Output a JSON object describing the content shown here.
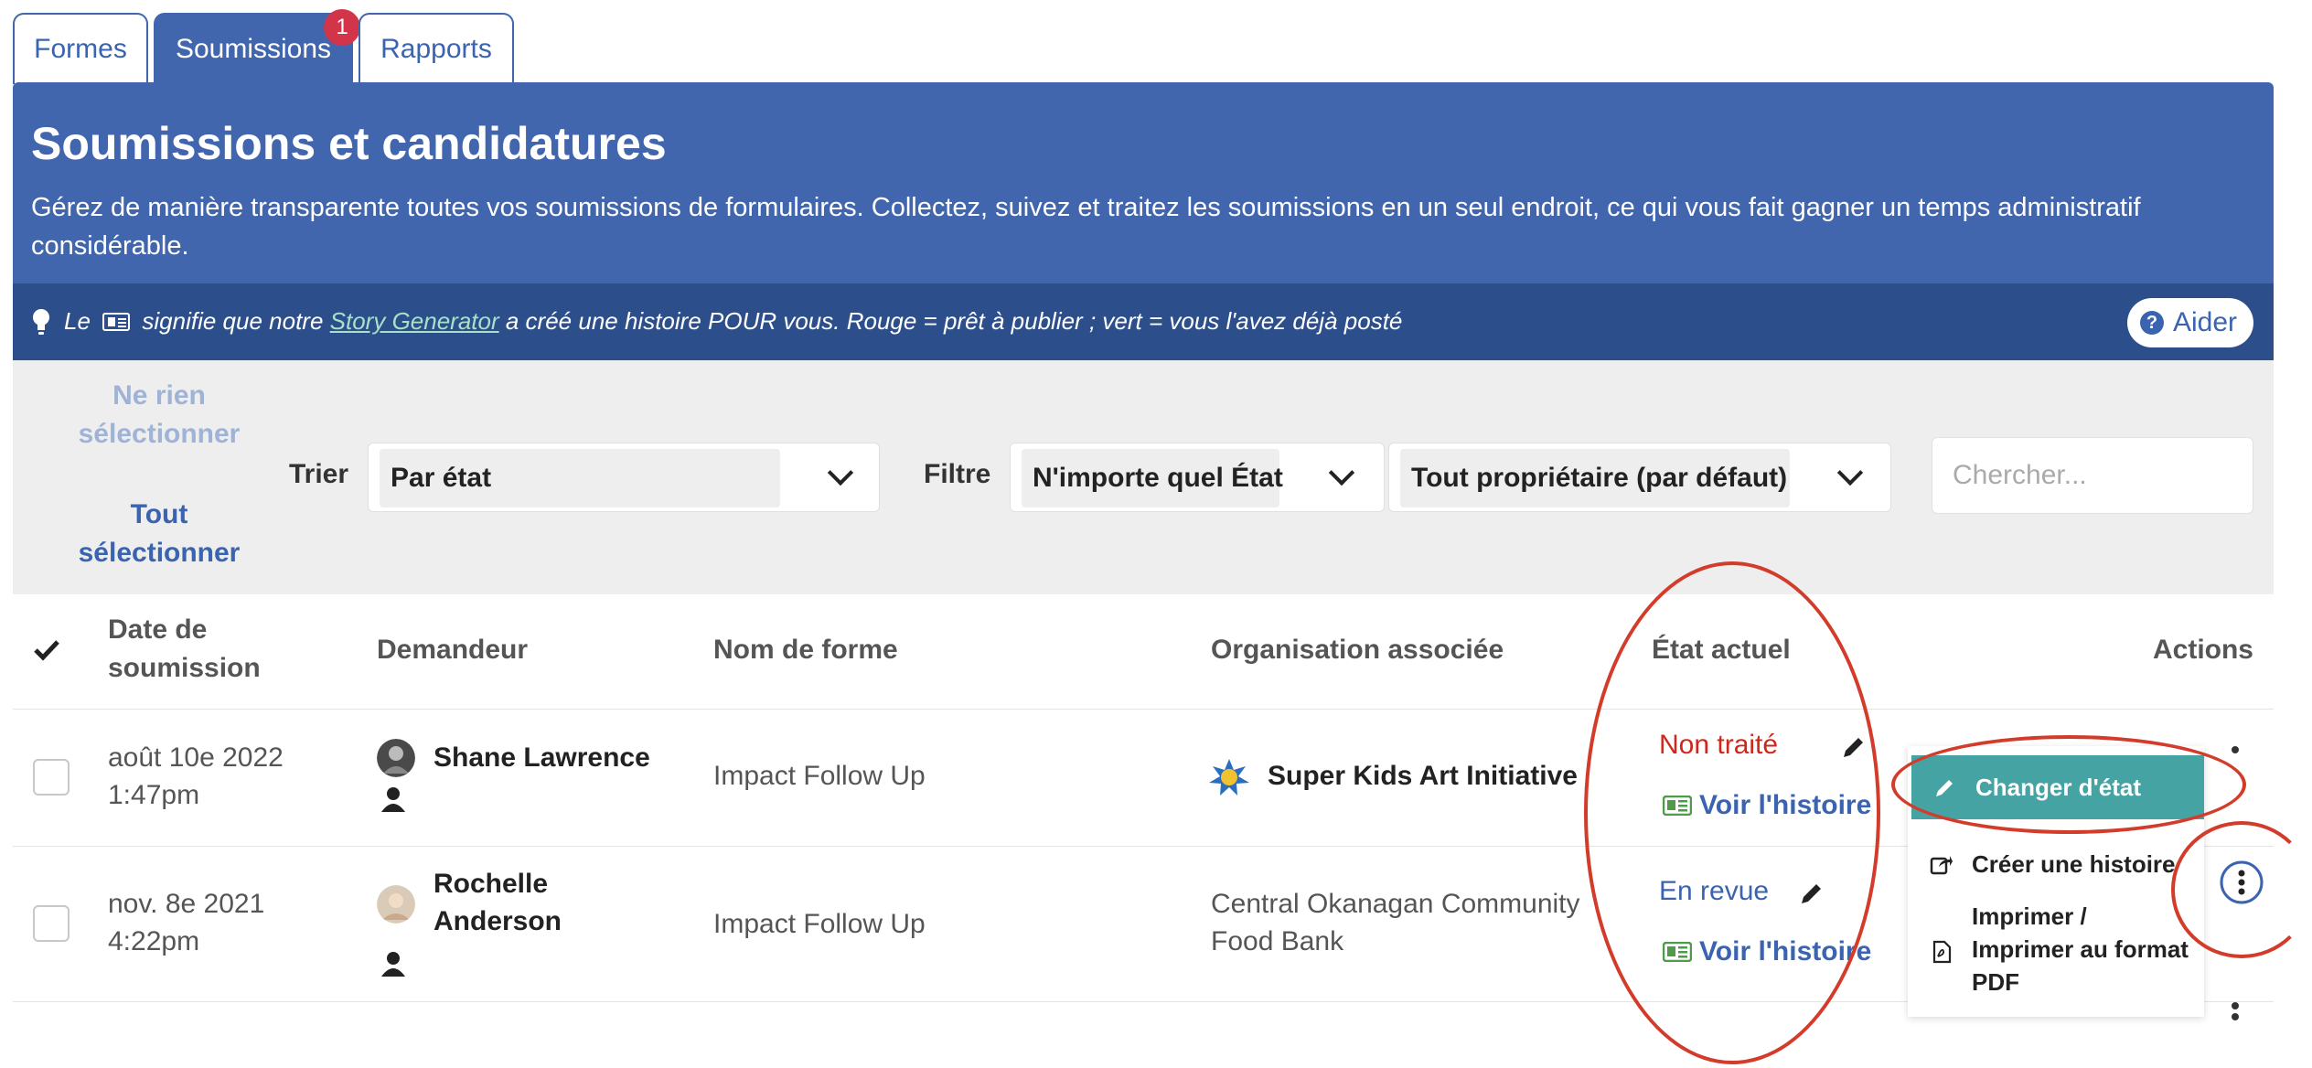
{
  "tabs": [
    {
      "label": "Formes"
    },
    {
      "label": "Soumissions",
      "badge": "1"
    },
    {
      "label": "Rapports"
    }
  ],
  "header": {
    "title": "Soumissions et candidatures",
    "description": "Gérez de manière transparente toutes vos soumissions de formulaires. Collectez, suivez et traitez les soumissions en un seul endroit, ce qui vous fait gagner un temps administratif considérable."
  },
  "infobar": {
    "prefix": "Le",
    "middle": "signifie que notre",
    "link": "Story Generator",
    "suffix": "a créé une histoire POUR vous. Rouge = prêt à publier ; vert = vous l'avez déjà posté",
    "help_label": "Aider"
  },
  "toolbar": {
    "select_none": "Ne rien sélectionner",
    "select_all": "Tout sélectionner",
    "sort_label": "Trier",
    "sort_value": "Par état",
    "filter_label": "Filtre",
    "filter_state_value": "N'importe quel État",
    "filter_owner_value": "Tout propriétaire (par défaut)",
    "search_placeholder": "Chercher..."
  },
  "table": {
    "headers": {
      "date": "Date de soumission",
      "applicant": "Demandeur",
      "form": "Nom de forme",
      "organization": "Organisation associée",
      "state": "État actuel",
      "actions": "Actions"
    },
    "rows": [
      {
        "date": "août 10e 2022",
        "time": "1:47pm",
        "applicant": "Shane Lawrence",
        "form": "Impact Follow Up",
        "organization": "Super Kids Art Initiative",
        "state": "Non traité",
        "story_link": "Voir l'histoire"
      },
      {
        "date": "nov. 8e 2021",
        "time": "4:22pm",
        "applicant_first": "Rochelle",
        "applicant_last": "Anderson",
        "form": "Impact Follow Up",
        "organization_line1": "Central Okanagan Community",
        "organization_line2": "Food Bank",
        "state": "En revue",
        "story_link": "Voir l'histoire"
      }
    ]
  },
  "actions_menu": {
    "change_state": "Changer d'état",
    "create_story": "Créer une histoire",
    "print_line1": "Imprimer /",
    "print_line2": "Imprimer au format",
    "print_line3": "PDF"
  },
  "colors": {
    "brand_blue": "#4166ae",
    "dark_blue": "#2c4f8c",
    "state_red": "#d0271d",
    "teal": "#46a3a4",
    "annotation_red": "#d33b2a"
  }
}
